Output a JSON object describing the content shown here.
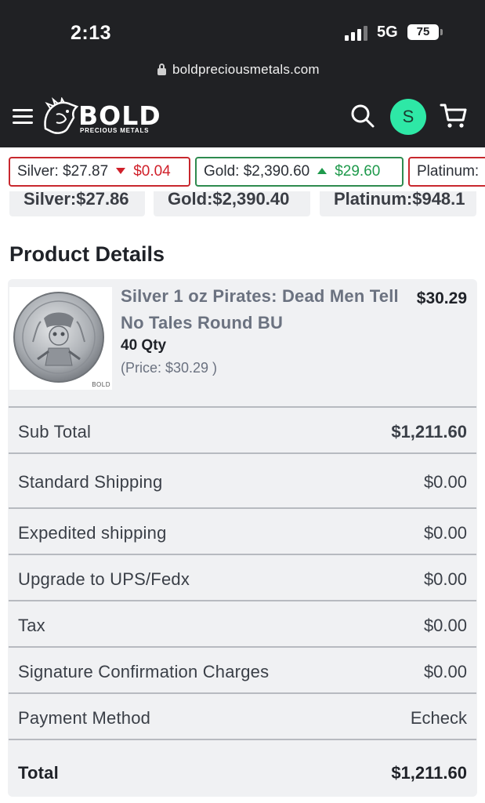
{
  "status_bar": {
    "time": "2:13",
    "network": "5G",
    "battery": "75"
  },
  "browser": {
    "url": "boldpreciousmetals.com"
  },
  "header": {
    "logo_text": "BOLD",
    "logo_subtext": "PRECIOUS METALS",
    "avatar_initial": "S",
    "icons": [
      "menu-icon",
      "search-icon",
      "cart-icon"
    ]
  },
  "ticker": [
    {
      "metal": "Silver: $27.87",
      "change": "$0.04",
      "direction": "down",
      "color": "#d0202a"
    },
    {
      "metal": "Gold: $2,390.60",
      "change": "$29.60",
      "direction": "up",
      "color": "#1f9a4c"
    },
    {
      "metal": "Platinum:",
      "change": "",
      "direction": "",
      "color": ""
    }
  ],
  "spot_prices": [
    "Silver:$27.86",
    "Gold:$2,390.40",
    "Platinum:$948.1"
  ],
  "product_details": {
    "title": "Product Details",
    "item": {
      "name": "Silver 1 oz Pirates: Dead Men Tell No Tales Round BU",
      "quantity": "40 Qty",
      "unit_price": "(Price: $30.29 )",
      "price": "$30.29",
      "image_brand": "BOLD"
    },
    "summary": [
      {
        "label": "Sub Total",
        "value": "$1,211.60"
      },
      {
        "label": "Standard Shipping",
        "value": "$0.00"
      },
      {
        "label": "Expedited shipping",
        "value": "$0.00"
      },
      {
        "label": "Upgrade to UPS/Fedx",
        "value": "$0.00"
      },
      {
        "label": "Tax",
        "value": "$0.00"
      },
      {
        "label": "Signature Confirmation Charges",
        "value": "$0.00"
      },
      {
        "label": "Payment Method",
        "value": "Echeck"
      }
    ],
    "total": {
      "label": "Total",
      "value": "$1,211.60"
    }
  },
  "colors": {
    "header_bg": "#202124",
    "avatar": "#2ee8a6",
    "up": "#1f9a4c",
    "down": "#d0202a"
  }
}
